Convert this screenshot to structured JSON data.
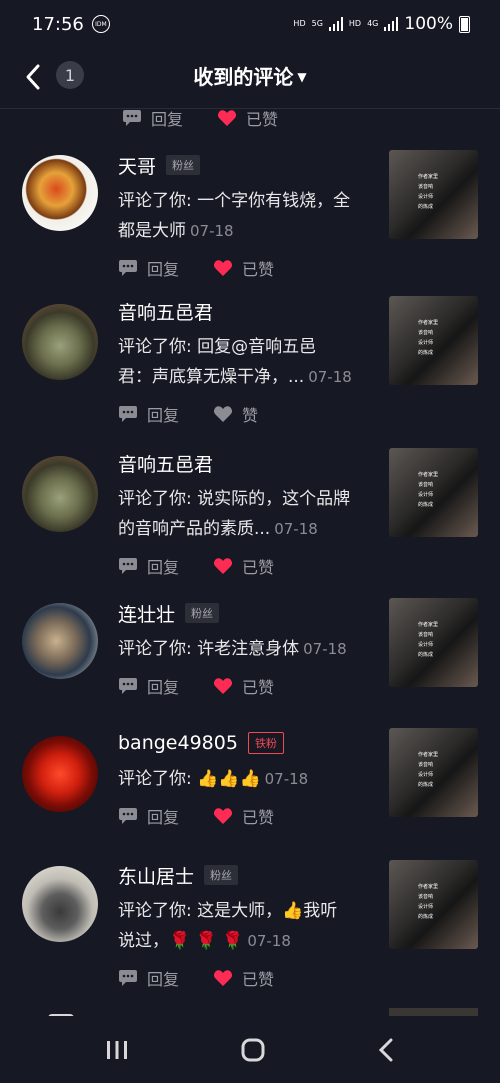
{
  "status": {
    "time": "17:56",
    "idm": "IDM",
    "hd1": "HD",
    "net": "5G",
    "hd2": "HD",
    "net2": "4G",
    "battery": "100%"
  },
  "header": {
    "count": "1",
    "title": "收到的评论"
  },
  "top_partial": {
    "reply": "回复",
    "liked": "已赞"
  },
  "items": [
    {
      "name": "天哥",
      "tag": "粉丝",
      "line1": "评论了你: 一个字你有钱烧，全",
      "line2": "都是大师",
      "date": "07-18",
      "reply": "回复",
      "like": "已赞",
      "liked": true
    },
    {
      "name": "音响五邑君",
      "tag": "",
      "line1": "评论了你: 回复@音响五邑",
      "line2": "君：声底算无燥干净，...",
      "date": "07-18",
      "reply": "回复",
      "like": "赞",
      "liked": false
    },
    {
      "name": "音响五邑君",
      "tag": "",
      "line1": "评论了你: 说实际的，这个品牌",
      "line2": "的音响产品的素质...",
      "date": "07-18",
      "reply": "回复",
      "like": "已赞",
      "liked": true
    },
    {
      "name": "连壮壮",
      "tag": "粉丝",
      "line1": "评论了你: 许老注意身体",
      "line2": "",
      "date": "07-18",
      "reply": "回复",
      "like": "已赞",
      "liked": true
    },
    {
      "name": "bange49805",
      "tag": "铁粉",
      "line1": "评论了你: 👍👍👍",
      "line2": "",
      "date": "07-18",
      "reply": "回复",
      "like": "已赞",
      "liked": true
    },
    {
      "name": "东山居士",
      "tag": "粉丝",
      "line1": "评论了你: 这是大师，👍我听",
      "line2": "说过，🌹 🌹 🌹",
      "date": "07-18",
      "reply": "回复",
      "like": "已赞",
      "liked": true
    }
  ],
  "thumb_text": [
    "作者家里",
    "该音响",
    "设计师",
    "的炼成"
  ],
  "colors": {
    "background": "#161823",
    "like_red": "#fe2c55",
    "muted": "#9b9ca4"
  }
}
